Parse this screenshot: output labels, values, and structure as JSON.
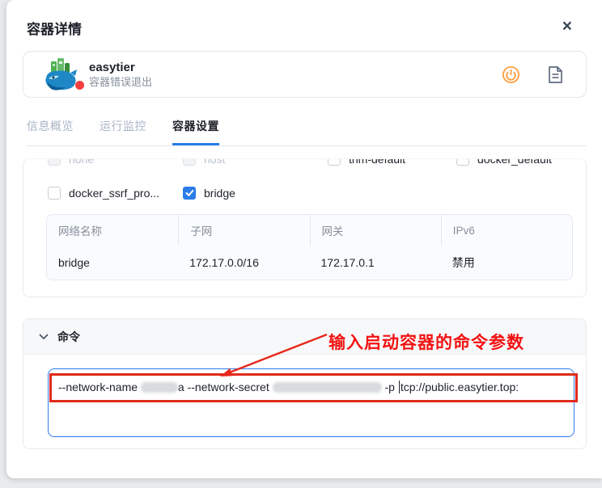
{
  "modal": {
    "title": "容器详情",
    "close_label": "×"
  },
  "container": {
    "name": "easytier",
    "status": "容器错误退出",
    "status_color": "#f53f3f",
    "logo_name": "easytier-whale-logo",
    "actions": [
      {
        "name": "power",
        "icon": "power-icon",
        "color": "#ff9d3c"
      },
      {
        "name": "log-file",
        "icon": "log-file-icon",
        "color": "#5f6b7e"
      }
    ]
  },
  "tabs": [
    {
      "label": "信息概览",
      "active": false
    },
    {
      "label": "运行监控",
      "active": false
    },
    {
      "label": "容器设置",
      "active": true
    }
  ],
  "colors": {
    "accent_blue": "#2b7cea",
    "annotation_red": "#f31212",
    "arrow_red": "#e8281b"
  },
  "network": {
    "options": [
      {
        "label": "none",
        "checked": false,
        "disabled": true
      },
      {
        "label": "host",
        "checked": false,
        "disabled": true
      },
      {
        "label": "thm-default",
        "checked": false,
        "disabled": false
      },
      {
        "label": "docker_default",
        "checked": false,
        "disabled": false
      },
      {
        "label": "docker_ssrf_pro...",
        "checked": false,
        "disabled": false
      },
      {
        "label": "bridge",
        "checked": true,
        "disabled": false
      }
    ],
    "table": {
      "headers": [
        "网络名称",
        "子网",
        "网关",
        "IPv6"
      ],
      "rows": [
        [
          "bridge",
          "172.17.0.0/16",
          "172.17.0.1",
          "禁用"
        ]
      ]
    }
  },
  "command": {
    "section_title": "命令",
    "annotation": "输入启动容器的命令参数",
    "value_parts": [
      {
        "type": "text",
        "value": "--network-name "
      },
      {
        "type": "redacted",
        "width": 46
      },
      {
        "type": "text",
        "value": "a --network-secret "
      },
      {
        "type": "redacted",
        "width": 135
      },
      {
        "type": "text",
        "value": " -p "
      },
      {
        "type": "cursor"
      },
      {
        "type": "text",
        "value": "tcp://public.easytier.top:"
      }
    ]
  }
}
